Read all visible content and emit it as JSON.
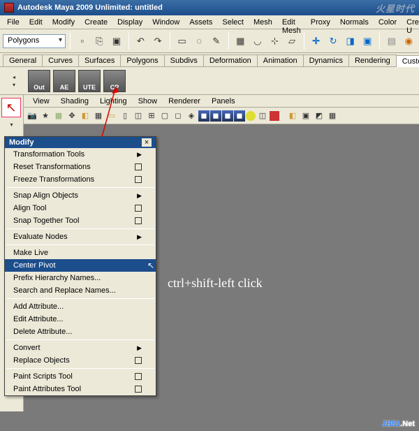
{
  "title": "Autodesk Maya 2009 Unlimited: untitled",
  "menubar": [
    "File",
    "Edit",
    "Modify",
    "Create",
    "Display",
    "Window",
    "Assets",
    "Select",
    "Mesh",
    "Edit Mesh",
    "Proxy",
    "Normals",
    "Color",
    "Create U"
  ],
  "mode_dropdown": "Polygons",
  "shelf_tabs": [
    "General",
    "Curves",
    "Surfaces",
    "Polygons",
    "Subdivs",
    "Deformation",
    "Animation",
    "Dynamics",
    "Rendering",
    "Custom"
  ],
  "shelf_active_tab": "Custom",
  "shelf_buttons": [
    "Out",
    "AE",
    "UTE",
    "CP"
  ],
  "view_menus": [
    "View",
    "Shading",
    "Lighting",
    "Show",
    "Renderer",
    "Panels"
  ],
  "ctx": {
    "title": "Modify",
    "items": [
      {
        "label": "Transformation Tools",
        "sub": true
      },
      {
        "label": "Reset Transformations",
        "box": true
      },
      {
        "label": "Freeze Transformations",
        "box": true
      },
      {
        "sep": true
      },
      {
        "label": "Snap Align Objects",
        "sub": true
      },
      {
        "label": "Align Tool",
        "box": true
      },
      {
        "label": "Snap Together Tool",
        "box": true
      },
      {
        "sep": true
      },
      {
        "label": "Evaluate Nodes",
        "sub": true
      },
      {
        "sep": true
      },
      {
        "label": "Make Live"
      },
      {
        "label": "Center Pivot",
        "hl": true
      },
      {
        "label": "Prefix Hierarchy Names..."
      },
      {
        "label": "Search and Replace Names..."
      },
      {
        "sep": true
      },
      {
        "label": "Add Attribute..."
      },
      {
        "label": "Edit Attribute..."
      },
      {
        "label": "Delete Attribute..."
      },
      {
        "sep": true
      },
      {
        "label": "Convert",
        "sub": true
      },
      {
        "label": "Replace Objects",
        "box": true
      },
      {
        "sep": true
      },
      {
        "label": "Paint Scripts Tool",
        "box": true
      },
      {
        "label": "Paint Attributes Tool",
        "box": true
      }
    ]
  },
  "annotation": "ctrl+shift-left click",
  "watermark": "JB51",
  "watermark_suffix": ".Net",
  "watermark_top": "火星时代"
}
